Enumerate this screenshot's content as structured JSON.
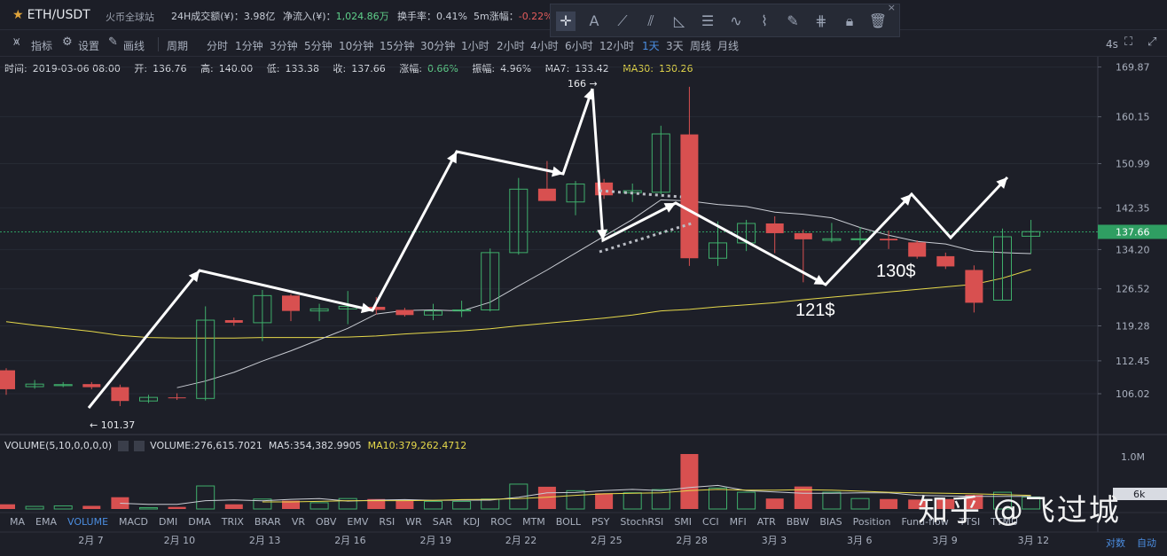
{
  "header": {
    "symbol": "ETH/USDT",
    "site": "火币全球站",
    "vol24h_label": "24H成交额(¥)：",
    "vol24h": "3.98亿",
    "netflow_label": "净流入(¥)：",
    "netflow": "1,024.86万",
    "turnover_label": "换手率：",
    "turnover": "0.41%",
    "change5m_label": "5m涨幅：",
    "change5m": "-0.22%"
  },
  "toolbar": {
    "indicators": "指标",
    "settings": "设置",
    "draw": "画线",
    "period_label": "周期",
    "periods": [
      "分时",
      "1分钟",
      "3分钟",
      "5分钟",
      "10分钟",
      "15分钟",
      "30分钟",
      "1小时",
      "2小时",
      "4小时",
      "6小时",
      "12小时",
      "1天",
      "3天",
      "周线",
      "月线"
    ],
    "active_period": "1天",
    "refresh": "4s"
  },
  "ohlc": {
    "time_label": "时间:",
    "time": "2019-03-06 08:00",
    "open_label": "开:",
    "open": "136.76",
    "high_label": "高:",
    "high": "140.00",
    "low_label": "低:",
    "low": "133.38",
    "close_label": "收:",
    "close": "137.66",
    "chg_label": "涨幅:",
    "chg": "0.66%",
    "amp_label": "振幅:",
    "amp": "4.96%",
    "ma7_label": "MA7:",
    "ma7": "133.42",
    "ma30_label": "MA30:",
    "ma30": "130.26"
  },
  "volume_info": {
    "title": "VOLUME(5,10,0,0,0,0)",
    "volume_label": "VOLUME:",
    "volume": "276,615.7021",
    "ma5_label": "MA5:",
    "ma5": "354,382.9905",
    "ma10_label": "MA10:",
    "ma10": "379,262.4712"
  },
  "indicator_tabs": [
    "MA",
    "EMA",
    "VOLUME",
    "MACD",
    "DMI",
    "DMA",
    "TRIX",
    "BRAR",
    "VR",
    "OBV",
    "EMV",
    "RSI",
    "WR",
    "SAR",
    "KDJ",
    "ROC",
    "MTM",
    "BOLL",
    "PSY",
    "StochRSI",
    "SMI",
    "CCI",
    "MFI",
    "ATR",
    "BBW",
    "BIAS",
    "Position",
    "Fund-flow",
    "TTSI",
    "TTMU"
  ],
  "active_indicator": "VOLUME",
  "bottom_right": {
    "log": "对数",
    "auto": "自动"
  },
  "watermark": "知乎 @飞过城",
  "colors": {
    "up": "#3fae6b",
    "down": "#d85050",
    "ma7": "#c9ccd3",
    "ma30": "#e6d94b",
    "price_tag": "#2f9e62"
  },
  "chart_data": {
    "type": "candlestick",
    "price_axis_ticks": [
      169.87,
      160.15,
      150.99,
      142.35,
      134.2,
      126.52,
      119.28,
      112.45,
      106.02
    ],
    "current_price": "137.66",
    "volume_axis_ticks": [
      "1.0M",
      "6k"
    ],
    "x_tick_labels": [
      "2月 7",
      "2月 10",
      "2月 13",
      "2月 16",
      "2月 19",
      "2月 22",
      "2月 25",
      "2月 28",
      "3月 3",
      "3月 6",
      "3月 9",
      "3月 12"
    ],
    "candles": [
      {
        "o": 110.6,
        "h": 111.0,
        "l": 105.8,
        "c": 106.9
      },
      {
        "o": 107.4,
        "h": 108.7,
        "l": 107.0,
        "c": 107.9
      },
      {
        "o": 107.6,
        "h": 108.3,
        "l": 107.3,
        "c": 107.8
      },
      {
        "o": 107.9,
        "h": 108.3,
        "l": 106.9,
        "c": 107.3
      },
      {
        "o": 107.3,
        "h": 107.8,
        "l": 103.6,
        "c": 104.6
      },
      {
        "o": 104.6,
        "h": 105.8,
        "l": 104.2,
        "c": 105.3
      },
      {
        "o": 105.3,
        "h": 106.1,
        "l": 104.8,
        "c": 105.2
      },
      {
        "o": 105.1,
        "h": 123.1,
        "l": 104.7,
        "c": 120.4
      },
      {
        "o": 120.4,
        "h": 120.9,
        "l": 119.3,
        "c": 119.9
      },
      {
        "o": 119.9,
        "h": 126.3,
        "l": 116.3,
        "c": 125.2
      },
      {
        "o": 125.2,
        "h": 125.5,
        "l": 120.2,
        "c": 122.2
      },
      {
        "o": 122.2,
        "h": 123.6,
        "l": 120.2,
        "c": 122.6
      },
      {
        "o": 122.6,
        "h": 126.1,
        "l": 119.6,
        "c": 123.1
      },
      {
        "o": 123.0,
        "h": 124.9,
        "l": 121.5,
        "c": 122.4
      },
      {
        "o": 122.4,
        "h": 122.8,
        "l": 121.1,
        "c": 121.4
      },
      {
        "o": 121.4,
        "h": 123.6,
        "l": 120.4,
        "c": 122.2
      },
      {
        "o": 122.2,
        "h": 124.2,
        "l": 121.0,
        "c": 122.4
      },
      {
        "o": 122.4,
        "h": 134.4,
        "l": 122.1,
        "c": 133.6
      },
      {
        "o": 133.6,
        "h": 148.2,
        "l": 133.2,
        "c": 146.0
      },
      {
        "o": 146.1,
        "h": 151.5,
        "l": 143.8,
        "c": 143.7
      },
      {
        "o": 143.5,
        "h": 147.6,
        "l": 140.9,
        "c": 147.0
      },
      {
        "o": 147.3,
        "h": 148.0,
        "l": 144.1,
        "c": 144.8
      },
      {
        "o": 145.3,
        "h": 147.1,
        "l": 143.5,
        "c": 145.7
      },
      {
        "o": 145.4,
        "h": 158.4,
        "l": 145.0,
        "c": 156.8
      },
      {
        "o": 156.7,
        "h": 166.0,
        "l": 131.0,
        "c": 132.5
      },
      {
        "o": 132.5,
        "h": 139.7,
        "l": 131.0,
        "c": 135.5
      },
      {
        "o": 135.5,
        "h": 140.0,
        "l": 133.9,
        "c": 139.3
      },
      {
        "o": 139.3,
        "h": 140.7,
        "l": 133.5,
        "c": 137.4
      },
      {
        "o": 137.4,
        "h": 138.1,
        "l": 127.8,
        "c": 136.2
      },
      {
        "o": 136.0,
        "h": 139.4,
        "l": 135.6,
        "c": 136.3
      },
      {
        "o": 136.3,
        "h": 138.6,
        "l": 135.1,
        "c": 136.3
      },
      {
        "o": 136.3,
        "h": 137.9,
        "l": 134.3,
        "c": 136.0
      },
      {
        "o": 135.6,
        "h": 136.0,
        "l": 132.4,
        "c": 132.8
      },
      {
        "o": 132.9,
        "h": 133.6,
        "l": 130.4,
        "c": 130.9
      },
      {
        "o": 130.2,
        "h": 131.1,
        "l": 121.9,
        "c": 123.8
      },
      {
        "o": 124.3,
        "h": 138.3,
        "l": 124.3,
        "c": 136.7
      },
      {
        "o": 136.8,
        "h": 140.0,
        "l": 133.4,
        "c": 137.7
      }
    ],
    "ma7": [
      null,
      null,
      null,
      null,
      null,
      null,
      107.2,
      108.5,
      110.2,
      112.4,
      114.4,
      116.6,
      118.8,
      121.6,
      122.3,
      122.4,
      122.2,
      123.9,
      127.1,
      130.2,
      133.5,
      136.8,
      140.1,
      143.9,
      143.7,
      143.0,
      142.6,
      141.5,
      141.1,
      140.4,
      138.5,
      137.0,
      135.8,
      135.3,
      133.9,
      133.6,
      133.4
    ],
    "ma30": [
      120.1,
      119.4,
      118.8,
      118.2,
      117.4,
      117.0,
      116.9,
      116.9,
      116.9,
      117.0,
      117.0,
      117.0,
      117.1,
      117.3,
      117.7,
      118.0,
      118.3,
      118.7,
      119.3,
      119.8,
      120.3,
      120.8,
      121.4,
      122.2,
      122.5,
      123.0,
      123.4,
      123.8,
      124.4,
      124.9,
      125.4,
      125.9,
      126.4,
      126.9,
      127.4,
      128.6,
      130.3
    ],
    "volumes": [
      18,
      10,
      12,
      12,
      45,
      5,
      8,
      88,
      18,
      38,
      32,
      24,
      40,
      38,
      33,
      29,
      29,
      38,
      95,
      85,
      70,
      60,
      62,
      74,
      210,
      80,
      64,
      40,
      86,
      64,
      40,
      38,
      36,
      38,
      54,
      64,
      46
    ],
    "vol_ma5": [
      null,
      null,
      null,
      null,
      22,
      18,
      18,
      32,
      35,
      31,
      37,
      40,
      30,
      34,
      36,
      33,
      34,
      34,
      45,
      62,
      63,
      70,
      75,
      70,
      82,
      90,
      70,
      65,
      60,
      60,
      62,
      62,
      52,
      50,
      48,
      48,
      48
    ],
    "vol_ma10": [
      null,
      null,
      null,
      null,
      null,
      null,
      null,
      null,
      null,
      27,
      27,
      29,
      32,
      32,
      32,
      33,
      36,
      37,
      40,
      45,
      52,
      58,
      60,
      62,
      70,
      75,
      72,
      72,
      74,
      72,
      68,
      64,
      62,
      60,
      58,
      55,
      52
    ],
    "annotations": [
      {
        "text": "← 101.37"
      },
      {
        "text": "166 →"
      },
      {
        "text": "121$"
      },
      {
        "text": "130$"
      }
    ]
  }
}
